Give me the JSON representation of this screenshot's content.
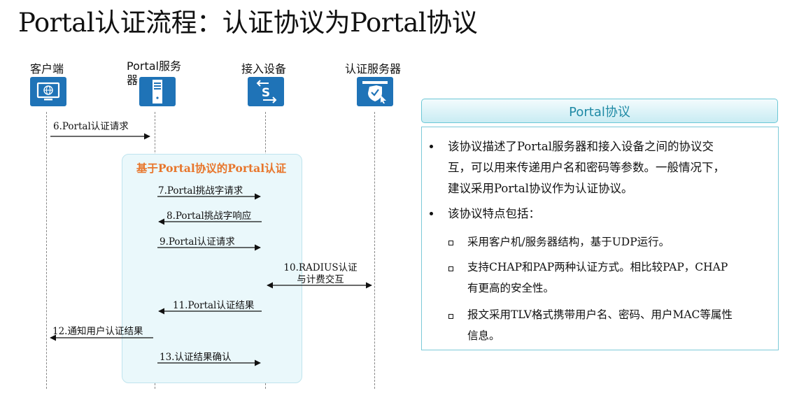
{
  "title": "Portal认证流程：认证协议为Portal协议",
  "actors": {
    "client": "客户端",
    "portal_server": "Portal服务器",
    "access_device": "接入设备",
    "auth_server": "认证服务器"
  },
  "group_title": "基于Portal协议的Portal认证",
  "messages": {
    "m6": "6.Portal认证请求",
    "m7": "7.Portal挑战字请求",
    "m8": "8.Portal挑战字响应",
    "m9": "9.Portal认证请求",
    "m10_line1": "10.RADIUS认证",
    "m10_line2": "与计费交互",
    "m11": "11.Portal认证结果",
    "m12": "12.通知用户认证结果",
    "m13": "13.认证结果确认"
  },
  "panel": {
    "header": "Portal协议",
    "bullet1_line1": "该协议描述了Portal服务器和接入设备之间的协议交",
    "bullet1_line2": "互，可以用来传递用户名和密码等参数。一般情况下，",
    "bullet1_line3": "建议采用Portal协议作为认证协议。",
    "bullet2": "该协议特点包括：",
    "sub1": "采用客户机/服务器结构，基于UDP运行。",
    "sub2_line1": "支持CHAP和PAP两种认证方式。相比较PAP，CHAP",
    "sub2_line2": "有更高的安全性。",
    "sub3_line1": "报文采用TLV格式携带用户名、密码、用户MAC等属性",
    "sub3_line2": "信息。"
  },
  "colors": {
    "icon_blue": "#1f73b7",
    "group_title": "#e8762c",
    "panel_header": "#1f8aa5"
  },
  "icons": [
    "monitor-globe-icon",
    "server-icon",
    "switch-icon",
    "shield-check-icon"
  ]
}
